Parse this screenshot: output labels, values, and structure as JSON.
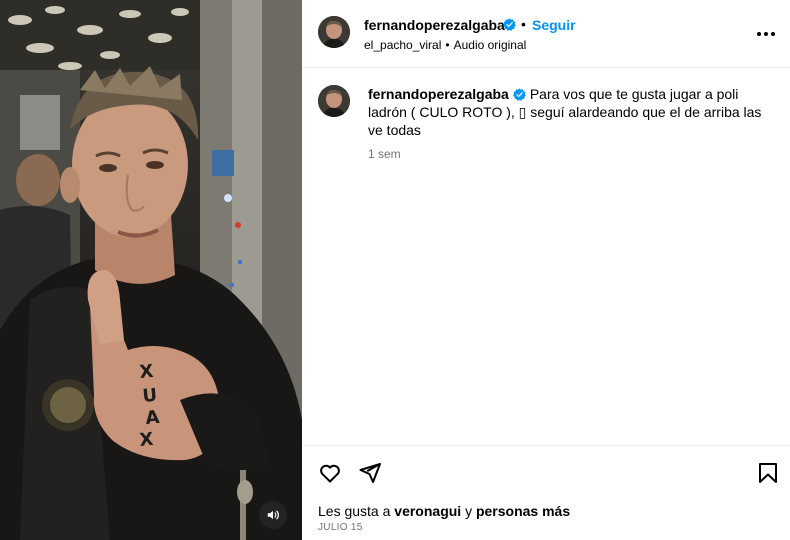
{
  "post": {
    "author": "fernandoperezalgaba",
    "follow_label": "Seguir",
    "separator": "•",
    "audio_user": "el_pacho_viral",
    "audio_label": "Audio original",
    "caption": "Para vos que te gusta jugar a poli ladrón ( CULO ROTO ), ▯ seguí alardeando que el de arriba las ve todas",
    "time_ago": "1 sem",
    "likes_prefix": "Les gusta a",
    "likes_user": "veronagui",
    "likes_connector": "y",
    "likes_rest": "personas más",
    "date": "JULIO 15"
  },
  "media": {
    "type": "video",
    "description_icons": [
      "volume-icon"
    ],
    "finger_tattoo": [
      "X",
      "A",
      "U",
      "X"
    ]
  },
  "icons": {
    "like": "heart-icon",
    "share": "paper-plane-icon",
    "save": "bookmark-icon",
    "more": "more-options-icon",
    "verified": "verified-badge-icon"
  },
  "colors": {
    "link_blue": "#0095f6",
    "secondary_text": "#737373",
    "divider": "#efefef"
  }
}
